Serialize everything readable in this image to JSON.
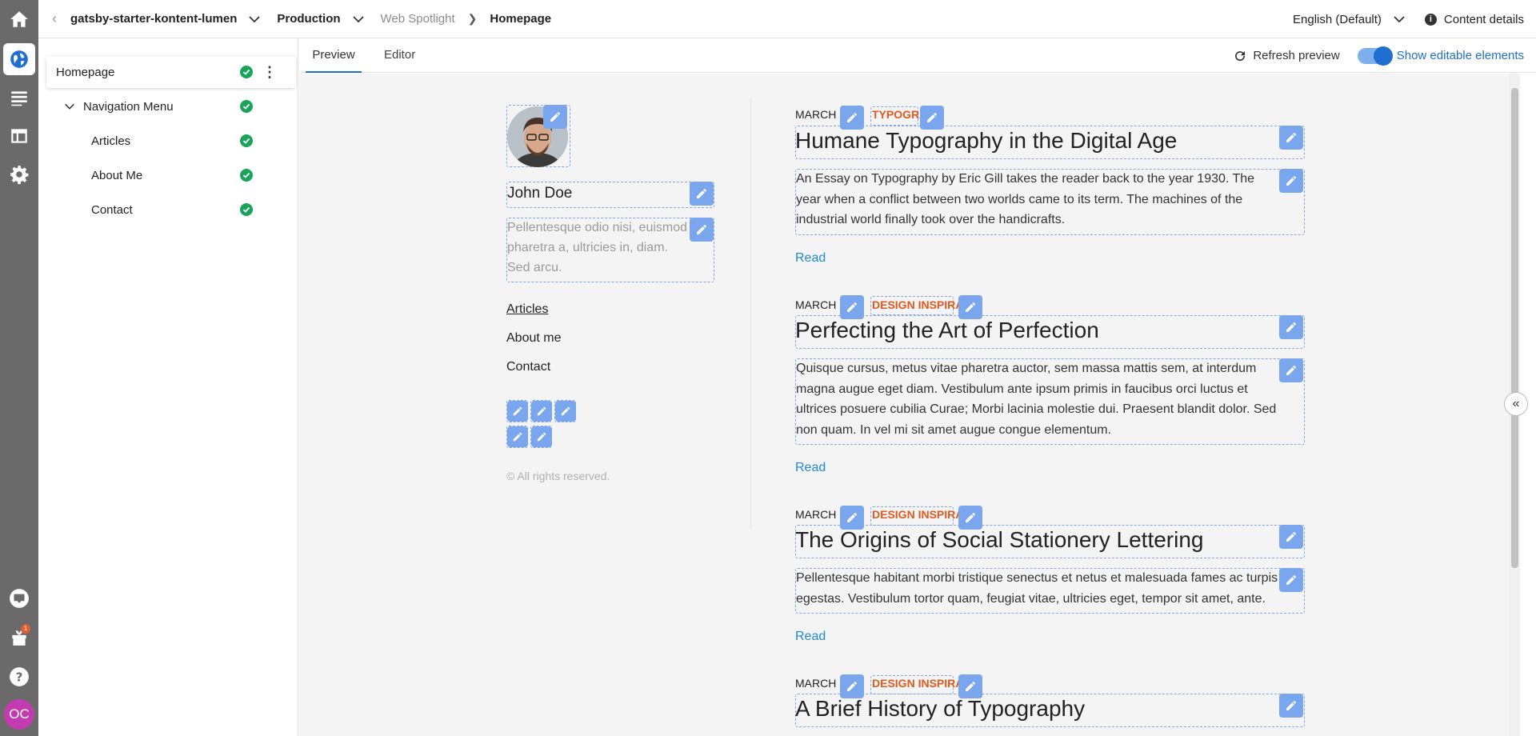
{
  "header": {
    "project": "gatsby-starter-kontent-lumen",
    "environment": "Production",
    "breadcrumb_app": "Web Spotlight",
    "breadcrumb_page": "Homepage",
    "language": "English (Default)",
    "content_details": "Content details"
  },
  "rail": {
    "notification_count": "1",
    "user_initials": "OC"
  },
  "tree": {
    "items": [
      {
        "label": "Homepage"
      },
      {
        "label": "Navigation Menu"
      },
      {
        "label": "Articles"
      },
      {
        "label": "About Me"
      },
      {
        "label": "Contact"
      }
    ]
  },
  "tabs": {
    "preview": "Preview",
    "editor": "Editor",
    "refresh": "Refresh preview",
    "show_editable": "Show editable elements",
    "show_editable_on": true
  },
  "site": {
    "author_name": "John Doe",
    "bio": "Pellentesque odio nisi, euismod pharetra a, ultricies in, diam. Sed arcu.",
    "menu": [
      "Articles",
      "About me",
      "Contact"
    ],
    "copyright": "© All rights reserved."
  },
  "posts": [
    {
      "date": "MARCH 2",
      "category": "TYPOGRA",
      "title": "Humane Typography in the Digital Age",
      "body": "An Essay on Typography by Eric Gill takes the reader back to the year 1930. The year when a conflict between two worlds came to its term. The machines of the industrial world finally took over the handicrafts.",
      "read": "Read"
    },
    {
      "date": "MARCH 2",
      "category": "DESIGN INSPIRAT",
      "title": "Perfecting the Art of Perfection",
      "body": "Quisque cursus, metus vitae pharetra auctor, sem massa mattis sem, at interdum magna augue eget diam. Vestibulum ante ipsum primis in faucibus orci luctus et ultrices posuere cubilia Curae; Morbi lacinia molestie dui. Praesent blandit dolor. Sed non quam. In vel mi sit amet augue congue elementum.",
      "read": "Read"
    },
    {
      "date": "MARCH 2",
      "category": "DESIGN INSPIRAT",
      "title": "The Origins of Social Stationery Lettering",
      "body": "Pellentesque habitant morbi tristique senectus et netus et malesuada fames ac turpis egestas. Vestibulum tortor quam, feugiat vitae, ultricies eget, tempor sit amet, ante.",
      "read": "Read"
    },
    {
      "date": "MARCH 2",
      "category": "DESIGN INSPIRAT",
      "title": "A Brief History of Typography",
      "body": "",
      "read": ""
    }
  ],
  "colors": {
    "accent": "#1f6fd1",
    "success": "#1aa45a",
    "category": "#e05a1f",
    "rail": "#6a6a6a",
    "editable_outline": "#7fa8ec"
  }
}
